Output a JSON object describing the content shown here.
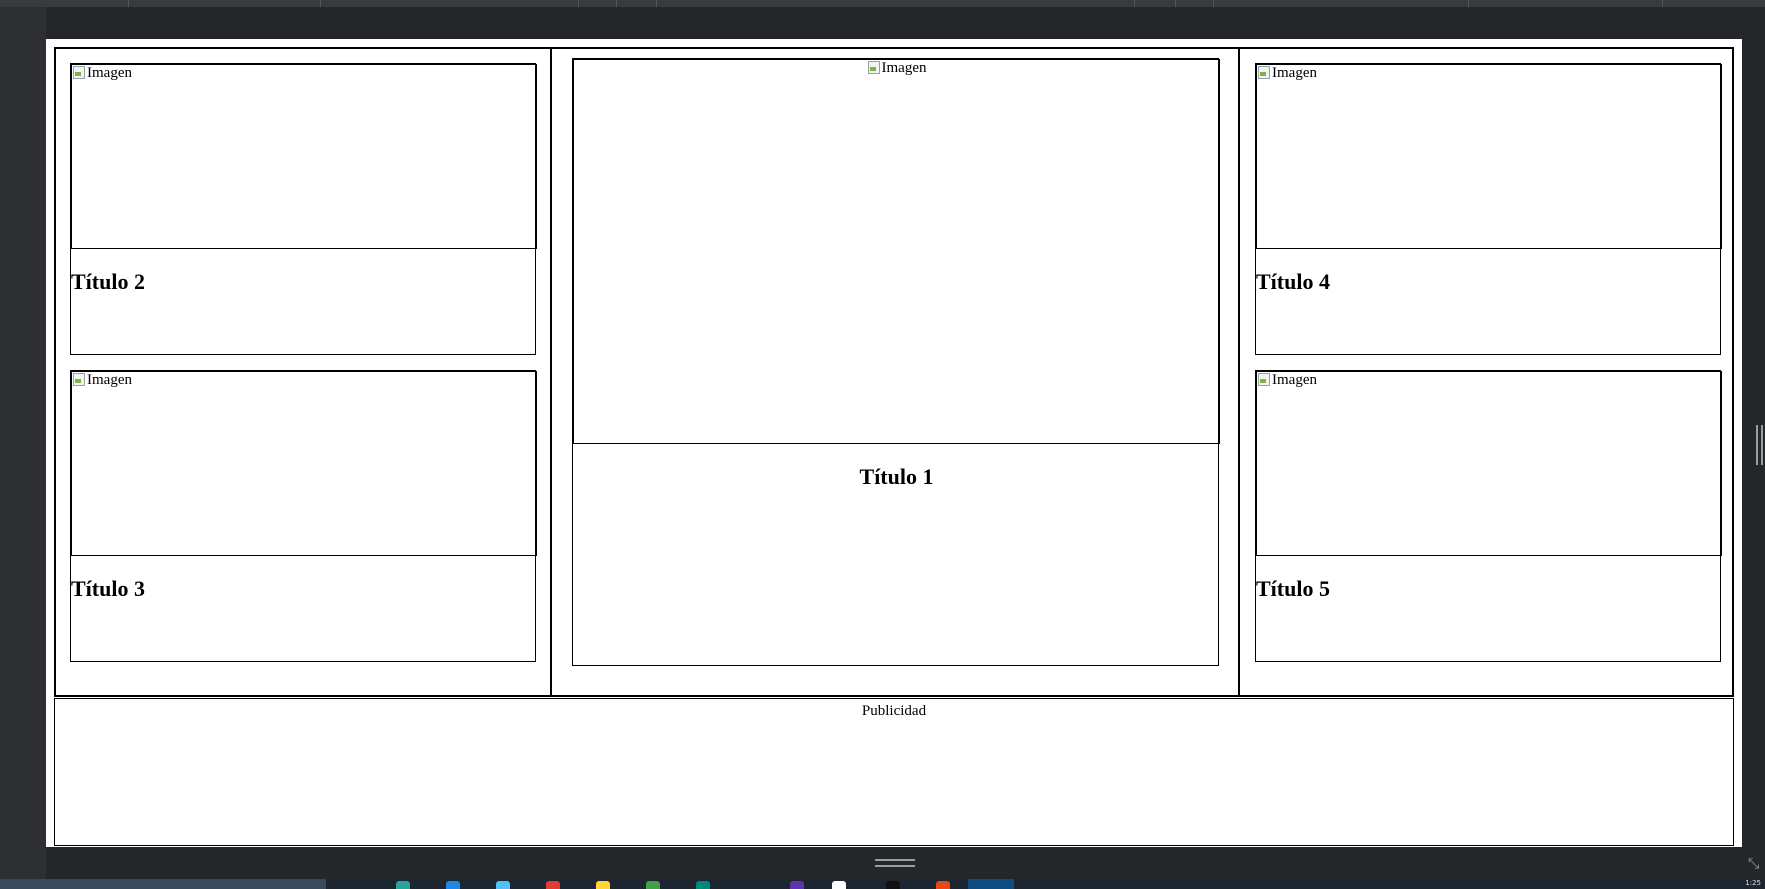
{
  "cards": {
    "t1": {
      "img_alt": "Imagen",
      "title": "Título 1"
    },
    "t2": {
      "img_alt": "Imagen",
      "title": "Título 2"
    },
    "t3": {
      "img_alt": "Imagen",
      "title": "Título 3"
    },
    "t4": {
      "img_alt": "Imagen",
      "title": "Título 4"
    },
    "t5": {
      "img_alt": "Imagen",
      "title": "Título 5"
    }
  },
  "ad": {
    "label": "Publicidad"
  },
  "taskbar": {
    "clock": "1:25"
  }
}
